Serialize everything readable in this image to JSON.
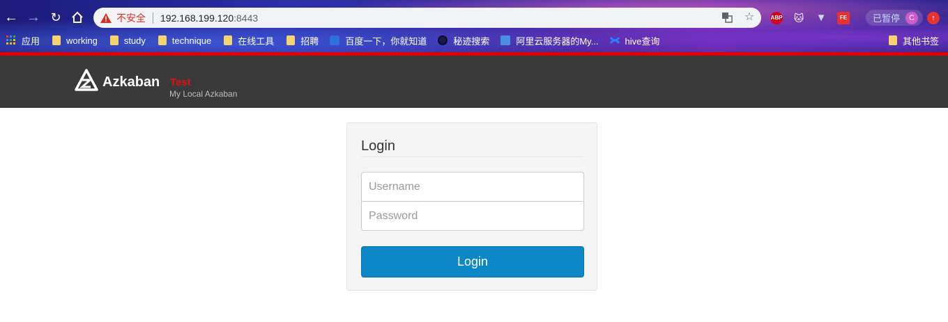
{
  "browser": {
    "insecure_label": "不安全",
    "url_host": "192.168.199.120",
    "url_port": ":8443",
    "paused_label": "已暂停",
    "avatar_letter": "C",
    "ext_abp": "ABP",
    "ext_fe": "FE",
    "bookmarks": [
      {
        "label": "应用",
        "icon": "apps-grid-icon"
      },
      {
        "label": "working",
        "icon": "folder-icon"
      },
      {
        "label": "study",
        "icon": "folder-icon"
      },
      {
        "label": "technique",
        "icon": "folder-icon"
      },
      {
        "label": "在线工具",
        "icon": "folder-icon"
      },
      {
        "label": "招聘",
        "icon": "folder-icon"
      },
      {
        "label": "百度一下，你就知道",
        "icon": "baidu-icon"
      },
      {
        "label": "秘迹搜索",
        "icon": "mijisou-icon"
      },
      {
        "label": "阿里云服务器的My...",
        "icon": "feather-icon"
      },
      {
        "label": "hive查询",
        "icon": "confluence-icon"
      }
    ],
    "other_bookmarks": "其他书签"
  },
  "header": {
    "brand": "Azkaban",
    "env": "Test",
    "subtitle": "My Local Azkaban"
  },
  "login": {
    "title": "Login",
    "username_placeholder": "Username",
    "password_placeholder": "Password",
    "button_label": "Login",
    "accent_color": "#0d87c7"
  }
}
